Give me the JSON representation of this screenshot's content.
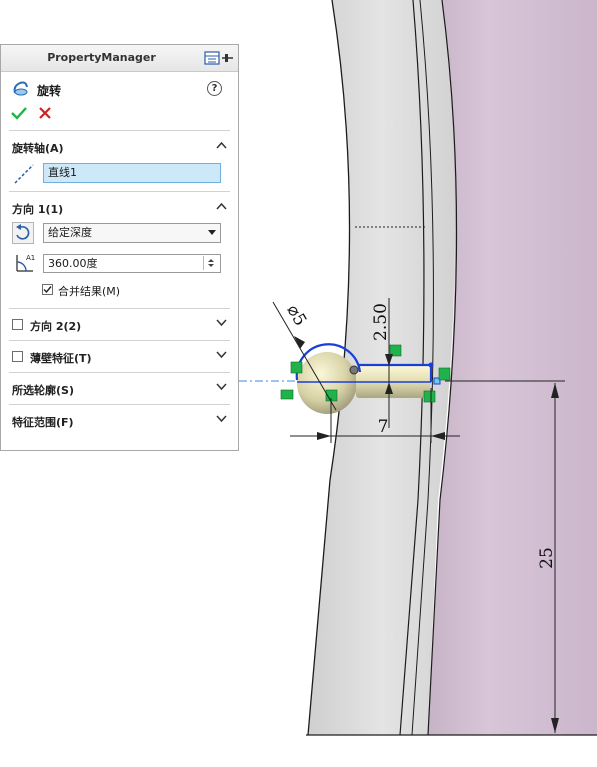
{
  "property_manager": {
    "title": "PropertyManager",
    "feature_name": "旋转",
    "help_label": "?",
    "sections": {
      "axis": {
        "header": "旋转轴(A)",
        "value": "直线1"
      },
      "direction1": {
        "header": "方向 1(1)",
        "end_condition": "给定深度",
        "angle": "360.00度",
        "merge_label": "合并结果(M)",
        "merge_checked": true
      },
      "direction2": {
        "header": "方向 2(2)",
        "checked": false
      },
      "thin": {
        "header": "薄壁特征(T)",
        "checked": false
      },
      "contours": {
        "header": "所选轮廓(S)"
      },
      "scope": {
        "header": "特征范围(F)"
      }
    }
  },
  "sketch": {
    "dimensions": {
      "diameter": "⌀5",
      "height": "2.50",
      "length": "7",
      "depth": "25"
    }
  },
  "colors": {
    "accent_green": "#1fb34a",
    "cancel_red": "#d02020",
    "sketch_blue": "#1a3fd6",
    "part_gray": "#d9d9d9",
    "part_purple": "#d6c2d6"
  }
}
